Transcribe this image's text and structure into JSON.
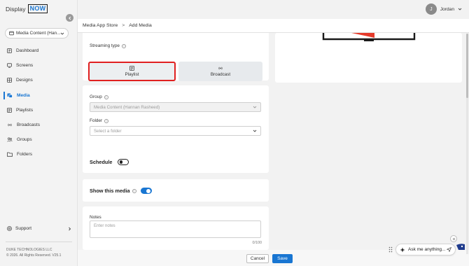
{
  "brand": {
    "display": "Display",
    "now": "NOW"
  },
  "workspace": {
    "label": "Media Content (Han..."
  },
  "nav": [
    {
      "label": "Dashboard",
      "icon": "dashboard-icon"
    },
    {
      "label": "Screens",
      "icon": "screens-icon"
    },
    {
      "label": "Designs",
      "icon": "designs-icon"
    },
    {
      "label": "Media",
      "icon": "media-icon",
      "active": true
    },
    {
      "label": "Playlists",
      "icon": "playlists-icon"
    },
    {
      "label": "Broadcasts",
      "icon": "broadcasts-icon"
    },
    {
      "label": "Groups",
      "icon": "groups-icon"
    },
    {
      "label": "Folders",
      "icon": "folders-icon"
    }
  ],
  "support": {
    "label": "Support"
  },
  "footer": {
    "company": "DUKE TECHNOLOGIES LLC",
    "copyright": "© 2026. All Rights Reserved. V25.1"
  },
  "user": {
    "initial": "J",
    "name": "Jordan"
  },
  "breadcrumb": {
    "parent": "Media App Store",
    "separator": ">",
    "current": "Add Media"
  },
  "streaming": {
    "label": "Streaming type",
    "options": [
      {
        "label": "Playlist",
        "selected": true
      },
      {
        "label": "Broadcast",
        "selected": false
      }
    ]
  },
  "group": {
    "label": "Group",
    "value": "Media Content (Hannan Rasheed)"
  },
  "folder": {
    "label": "Folder",
    "placeholder": "Select a folder"
  },
  "schedule": {
    "label": "Schedule",
    "enabled": false
  },
  "show_media": {
    "label": "Show this media",
    "enabled": true
  },
  "notes": {
    "label": "Notes",
    "placeholder": "Enter notes",
    "counter": "0/100"
  },
  "actions": {
    "cancel": "Cancel",
    "save": "Save"
  },
  "chat": {
    "label": "Ask me anything..."
  },
  "colors": {
    "accent": "#1976d2",
    "highlight": "#e02020"
  }
}
